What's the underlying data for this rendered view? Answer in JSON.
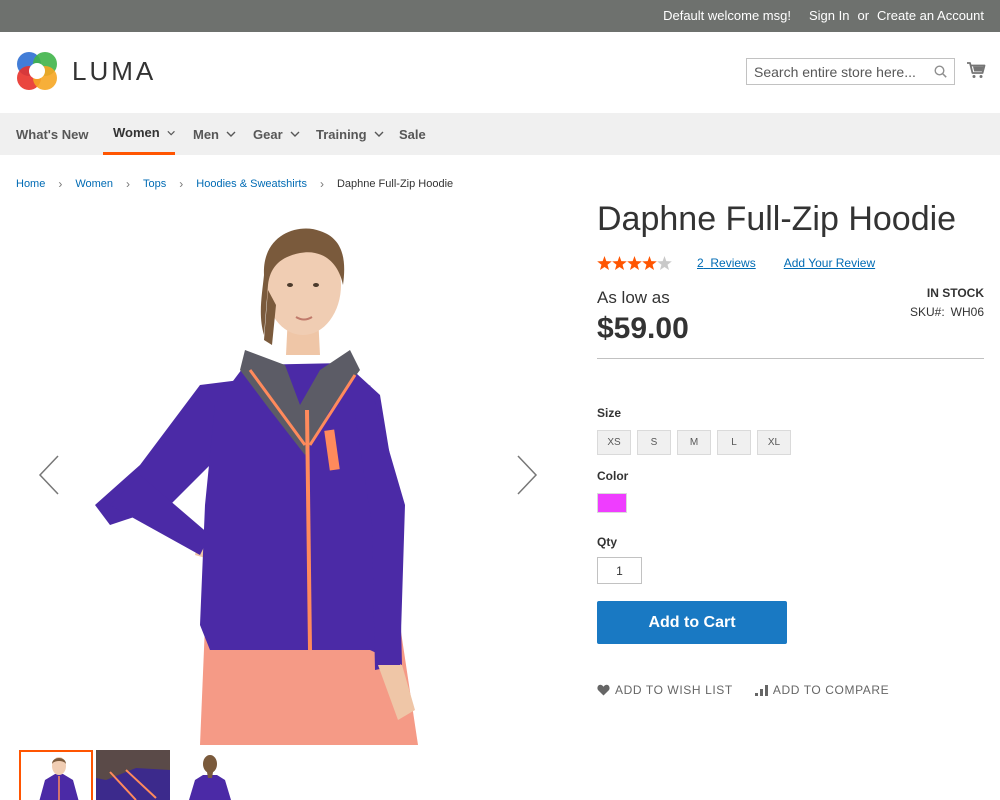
{
  "topbar": {
    "welcome": "Default welcome msg!",
    "sign_in": "Sign In",
    "or": "or",
    "create_account": "Create an Account"
  },
  "header": {
    "logo_text": "LUMA",
    "search_placeholder": "Search entire store here..."
  },
  "nav": {
    "items": [
      {
        "label": "What's New",
        "has_menu": false
      },
      {
        "label": "Women",
        "has_menu": true,
        "active": true
      },
      {
        "label": "Men",
        "has_menu": true
      },
      {
        "label": "Gear",
        "has_menu": true
      },
      {
        "label": "Training",
        "has_menu": true
      },
      {
        "label": "Sale",
        "has_menu": false
      }
    ]
  },
  "breadcrumb": [
    "Home",
    "Women",
    "Tops",
    "Hoodies & Sweatshirts",
    "Daphne Full-Zip Hoodie"
  ],
  "product": {
    "name": "Daphne Full-Zip Hoodie",
    "rating_stars": 4,
    "rating_max": 5,
    "reviews_count": "2",
    "reviews_label": "Reviews",
    "add_review": "Add Your Review",
    "price_prefix": "As low as",
    "price": "$59.00",
    "stock": "IN STOCK",
    "sku_label": "SKU#:",
    "sku": "WH06"
  },
  "options": {
    "size_label": "Size",
    "sizes": [
      "XS",
      "S",
      "M",
      "L",
      "XL"
    ],
    "color_label": "Color",
    "color_swatch": "#ef3dff",
    "qty_label": "Qty",
    "qty_value": "1"
  },
  "actions": {
    "add_to_cart": "Add to Cart",
    "wish_list": "ADD TO WISH LIST",
    "compare": "ADD TO COMPARE"
  },
  "colors": {
    "topbar": "#6e716e",
    "accent": "#ff5501",
    "primary_button": "#1979c3",
    "link": "#006bb4",
    "star_on": "#ff5501",
    "star_off": "#c9c9c9"
  },
  "icons": {
    "search": "search-icon",
    "cart": "cart-icon",
    "wish": "heart-icon",
    "compare": "bar-chart-icon",
    "prev": "chevron-left-icon",
    "next": "chevron-right-icon"
  }
}
